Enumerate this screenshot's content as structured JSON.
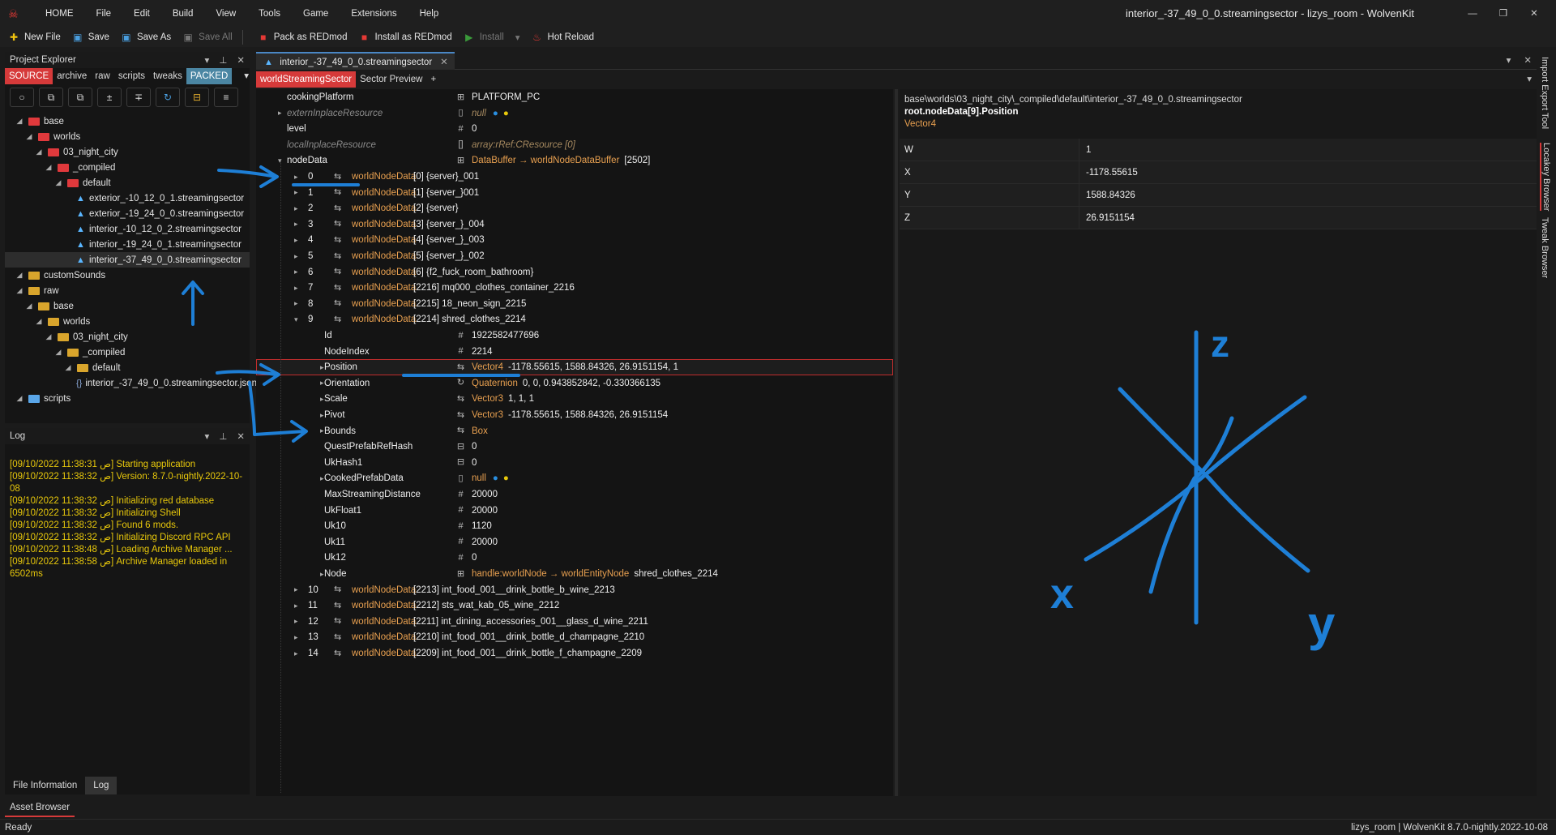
{
  "app": {
    "window_title": "interior_-37_49_0_0.streamingsector - lizys_room - WolvenKit"
  },
  "menu": [
    "HOME",
    "File",
    "Edit",
    "Build",
    "View",
    "Tools",
    "Game",
    "Extensions",
    "Help"
  ],
  "toolbar": {
    "new_file": "New File",
    "save": "Save",
    "save_as": "Save As",
    "save_all": "Save All",
    "pack": "Pack as REDmod",
    "install_redmod": "Install as REDmod",
    "install": "Install",
    "hot_reload": "Hot Reload"
  },
  "explorer": {
    "title": "Project Explorer",
    "tabs": [
      "SOURCE",
      "archive",
      "raw",
      "scripts",
      "tweaks",
      "PACKED"
    ],
    "tree": [
      {
        "label": "base",
        "depth": 0,
        "icon": "red"
      },
      {
        "label": "worlds",
        "depth": 1,
        "icon": "red"
      },
      {
        "label": "03_night_city",
        "depth": 2,
        "icon": "red"
      },
      {
        "label": "_compiled",
        "depth": 3,
        "icon": "red"
      },
      {
        "label": "default",
        "depth": 4,
        "icon": "red"
      },
      {
        "label": "exterior_-10_12_0_1.streamingsector",
        "depth": 5,
        "icon": "sector"
      },
      {
        "label": "exterior_-19_24_0_0.streamingsector",
        "depth": 5,
        "icon": "sector"
      },
      {
        "label": "interior_-10_12_0_2.streamingsector",
        "depth": 5,
        "icon": "sector"
      },
      {
        "label": "interior_-19_24_0_1.streamingsector",
        "depth": 5,
        "icon": "sector"
      },
      {
        "label": "interior_-37_49_0_0.streamingsector",
        "depth": 5,
        "icon": "sector"
      },
      {
        "label": "customSounds",
        "depth": 0,
        "icon": "yel"
      },
      {
        "label": "raw",
        "depth": 0,
        "icon": "yel"
      },
      {
        "label": "base",
        "depth": 1,
        "icon": "yel"
      },
      {
        "label": "worlds",
        "depth": 2,
        "icon": "yel"
      },
      {
        "label": "03_night_city",
        "depth": 3,
        "icon": "yel"
      },
      {
        "label": "_compiled",
        "depth": 4,
        "icon": "yel"
      },
      {
        "label": "default",
        "depth": 5,
        "icon": "yel"
      },
      {
        "label": "interior_-37_49_0_0.streamingsector.json",
        "depth": 6,
        "icon": "json"
      },
      {
        "label": "scripts",
        "depth": 0,
        "icon": "blu"
      }
    ]
  },
  "log": {
    "title": "Log",
    "lines": [
      "[09/10/2022 11:38:31 ص] Starting application",
      "[09/10/2022 11:38:32 ص] Version: 8.7.0-nightly.2022-10-08",
      "[09/10/2022 11:38:32 ص] Initializing red database",
      "[09/10/2022 11:38:32 ص] Initializing Shell",
      "[09/10/2022 11:38:32 ص] Found 6 mods.",
      "[09/10/2022 11:38:32 ص] Initializing Discord RPC API",
      "[09/10/2022 11:38:48 ص] Loading Archive Manager ...",
      "[09/10/2022 11:38:58 ص] Archive Manager loaded in 6502ms"
    ],
    "tabs": [
      "File Information",
      "Log"
    ]
  },
  "asset_browser": "Asset Browser",
  "status": {
    "left": "Ready",
    "right": "lizys_room | WolvenKit 8.7.0-nightly.2022-10-08"
  },
  "document": {
    "tab": "interior_-37_49_0_0.streamingsector",
    "subtabs": [
      "worldStreamingSector",
      "Sector Preview"
    ],
    "rows": [
      {
        "name": "cookingPlatform",
        "type": "",
        "value": "PLATFORM_PC",
        "indent": 0,
        "icon": "enum"
      },
      {
        "name": "externInplaceResource",
        "type": "null",
        "value": "",
        "indent": 0,
        "arrow": true,
        "icon": "file",
        "italic": true
      },
      {
        "name": "level",
        "type": "",
        "value": "0",
        "indent": 0,
        "icon": "hash"
      },
      {
        "name": "localInplaceResource",
        "type": "array:rRef:CResource [0]",
        "value": "",
        "indent": 0,
        "icon": "array",
        "italic": true
      },
      {
        "name": "nodeData",
        "type": "DataBuffer → worldNodeDataBuffer",
        "value": "[2502]",
        "indent": 0,
        "arrow": true,
        "open": true,
        "icon": "buffer"
      },
      {
        "idx": "0",
        "name": "worldNodeData",
        "label": "[0] {server}_001",
        "indent": 1
      },
      {
        "idx": "1",
        "name": "worldNodeData",
        "label": "[1] {server_}001",
        "indent": 1
      },
      {
        "idx": "2",
        "name": "worldNodeData",
        "label": "[2] {server}",
        "indent": 1
      },
      {
        "idx": "3",
        "name": "worldNodeData",
        "label": "[3] {server_}_004",
        "indent": 1
      },
      {
        "idx": "4",
        "name": "worldNodeData",
        "label": "[4] {server_}_003",
        "indent": 1
      },
      {
        "idx": "5",
        "name": "worldNodeData",
        "label": "[5] {server_}_002",
        "indent": 1
      },
      {
        "idx": "6",
        "name": "worldNodeData",
        "label": "[6] {f2_fuck_room_bathroom}",
        "indent": 1
      },
      {
        "idx": "7",
        "name": "worldNodeData",
        "label": "[2216] mq000_clothes_container_2216",
        "indent": 1
      },
      {
        "idx": "8",
        "name": "worldNodeData",
        "label": "[2215] 18_neon_sign_2215",
        "indent": 1
      },
      {
        "idx": "9",
        "name": "worldNodeData",
        "label": "[2214] shred_clothes_2214",
        "indent": 1,
        "open": true
      },
      {
        "name": "Id",
        "type": "",
        "value": "1922582477696",
        "indent": 2,
        "icon": "hash"
      },
      {
        "name": "NodeIndex",
        "type": "",
        "value": "2214",
        "indent": 2,
        "icon": "hash"
      },
      {
        "name": "Position",
        "type": "Vector4",
        "value": "-1178.55615, 1588.84326, 26.9151154, 1",
        "indent": 2,
        "arrow": true,
        "icon": "vec",
        "selected": true
      },
      {
        "name": "Orientation",
        "type": "Quaternion",
        "value": "0, 0, 0.943852842, -0.330366135",
        "indent": 2,
        "arrow": true,
        "icon": "rot"
      },
      {
        "name": "Scale",
        "type": "Vector3",
        "value": "1, 1, 1",
        "indent": 2,
        "arrow": true,
        "icon": "vec"
      },
      {
        "name": "Pivot",
        "type": "Vector3",
        "value": "-1178.55615, 1588.84326, 26.9151154",
        "indent": 2,
        "arrow": true,
        "icon": "vec"
      },
      {
        "name": "Bounds",
        "type": "Box",
        "value": "",
        "indent": 2,
        "arrow": true,
        "icon": "vec"
      },
      {
        "name": "QuestPrefabRefHash",
        "type": "",
        "value": "0",
        "indent": 2,
        "icon": "bin"
      },
      {
        "name": "UkHash1",
        "type": "",
        "value": "0",
        "indent": 2,
        "icon": "bin"
      },
      {
        "name": "CookedPrefabData",
        "type": "null",
        "value": "",
        "indent": 2,
        "arrow": true,
        "icon": "file"
      },
      {
        "name": "MaxStreamingDistance",
        "type": "",
        "value": "20000",
        "indent": 2,
        "icon": "hash"
      },
      {
        "name": "UkFloat1",
        "type": "",
        "value": "20000",
        "indent": 2,
        "icon": "hash"
      },
      {
        "name": "Uk10",
        "type": "",
        "value": "1120",
        "indent": 2,
        "icon": "hash"
      },
      {
        "name": "Uk11",
        "type": "",
        "value": "20000",
        "indent": 2,
        "icon": "hash"
      },
      {
        "name": "Uk12",
        "type": "",
        "value": "0",
        "indent": 2,
        "icon": "hash"
      },
      {
        "name": "Node",
        "type": "handle:worldNode → worldEntityNode",
        "value": "shred_clothes_2214",
        "indent": 2,
        "arrow": true,
        "icon": "handle"
      },
      {
        "idx": "10",
        "name": "worldNodeData",
        "label": "[2213] int_food_001__drink_bottle_b_wine_2213",
        "indent": 1
      },
      {
        "idx": "11",
        "name": "worldNodeData",
        "label": "[2212] sts_wat_kab_05_wine_2212",
        "indent": 1
      },
      {
        "idx": "12",
        "name": "worldNodeData",
        "label": "[2211] int_dining_accessories_001__glass_d_wine_2211",
        "indent": 1
      },
      {
        "idx": "13",
        "name": "worldNodeData",
        "label": "[2210] int_food_001__drink_bottle_d_champagne_2210",
        "indent": 1
      },
      {
        "idx": "14",
        "name": "worldNodeData",
        "label": "[2209] int_food_001__drink_bottle_f_champagne_2209",
        "indent": 1
      }
    ]
  },
  "detail": {
    "path": "base\\worlds\\03_night_city\\_compiled\\default\\interior_-37_49_0_0.streamingsector",
    "node": "root.nodeData[9].Position",
    "type": "Vector4",
    "fields": [
      {
        "k": "W",
        "v": "1"
      },
      {
        "k": "X",
        "v": "-1178.55615"
      },
      {
        "k": "Y",
        "v": "1588.84326"
      },
      {
        "k": "Z",
        "v": "26.9151154"
      }
    ]
  },
  "side_tabs": [
    "Import Export Tool",
    "Locakey Browser",
    "Tweak Browser"
  ],
  "sketch": {
    "labels": [
      "z",
      "x",
      "y"
    ],
    "color": "#1e7fd6"
  },
  "colors": {
    "accent_red": "#d63a3a",
    "packed_blue": "#4b86a3",
    "type_orange": "#e8a050",
    "log_yellow": "#e8c80b",
    "annotation_blue": "#1e7fd6"
  }
}
